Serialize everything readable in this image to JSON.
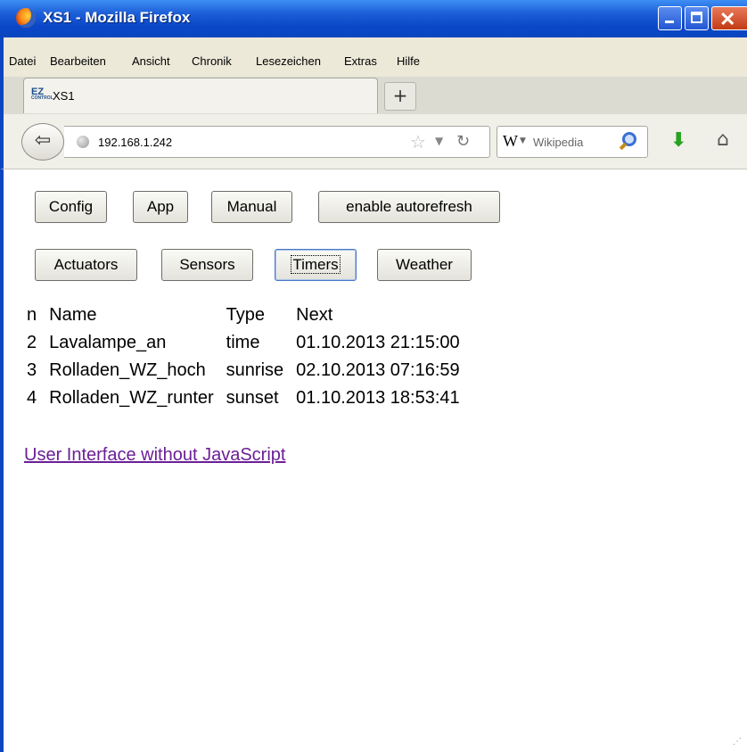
{
  "window": {
    "title": "XS1 - Mozilla Firefox"
  },
  "menu": [
    "Datei",
    "Bearbeiten",
    "Ansicht",
    "Chronik",
    "Lesezeichen",
    "Extras",
    "Hilfe"
  ],
  "tab": {
    "label": "XS1",
    "favicon_text": "EZ",
    "favicon_sub": "CONTROL"
  },
  "nav": {
    "url": "192.168.1.242",
    "search_placeholder": "Wikipedia"
  },
  "top_buttons": [
    "Config",
    "App",
    "Manual",
    "enable autorefresh"
  ],
  "category_buttons": [
    "Actuators",
    "Sensors",
    "Timers",
    "Weather"
  ],
  "active_category": "Timers",
  "timers": {
    "headers": [
      "n",
      "Name",
      "Type",
      "Next"
    ],
    "rows": [
      [
        "2",
        "Lavalampe_an",
        "time",
        "01.10.2013 21:15:00"
      ],
      [
        "3",
        "Rolladen_WZ_hoch",
        "sunrise",
        "02.10.2013 07:16:59"
      ],
      [
        "4",
        "Rolladen_WZ_runter",
        "sunset",
        "01.10.2013 18:53:41"
      ]
    ]
  },
  "link_text": "User Interface without JavaScript",
  "colors": {
    "titlebar": "#0b46c0",
    "link": "#6b1f96"
  }
}
